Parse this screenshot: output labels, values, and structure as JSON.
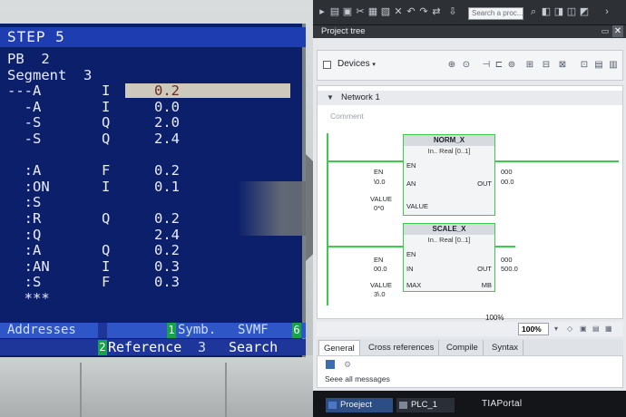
{
  "step5": {
    "title": "STEP 5",
    "lines": [
      {
        "c1": "PB  2",
        "c2": "",
        "c3": ""
      },
      {
        "c1": "Segment  3",
        "c2": "",
        "c3": ""
      },
      {
        "c1": "---A",
        "c2": "I",
        "c3": "0.2",
        "highlight": true
      },
      {
        "c1": "  -A",
        "c2": "I",
        "c3": "0.0"
      },
      {
        "c1": "  -S",
        "c2": "Q",
        "c3": "2.0"
      },
      {
        "c1": "  -S",
        "c2": "Q",
        "c3": "2.4"
      },
      {
        "c1": "",
        "c2": "",
        "c3": ""
      },
      {
        "c1": "  :A",
        "c2": "F",
        "c3": "0.2"
      },
      {
        "c1": "  :ON",
        "c2": "I",
        "c3": "0.1"
      },
      {
        "c1": "  :S",
        "c2": "",
        "c3": ""
      },
      {
        "c1": "  :R",
        "c2": "Q",
        "c3": "0.2"
      },
      {
        "c1": "  :Q",
        "c2": "",
        "c3": "2.4"
      },
      {
        "c1": "  :A",
        "c2": "Q",
        "c3": "0.2"
      },
      {
        "c1": "  :AN",
        "c2": "I",
        "c3": "0.3"
      },
      {
        "c1": "  :S",
        "c2": "F",
        "c3": "0.3"
      },
      {
        "c1": "  ***",
        "c2": "",
        "c3": ""
      }
    ],
    "fkeys": {
      "addresses": "Addresses",
      "symb_num": "1",
      "symb": "Symb.",
      "svmf": "SVMF",
      "k6": "6",
      "ref_num": "2",
      "reference": "Reference",
      "search_num": "3",
      "search": "Search"
    }
  },
  "tia": {
    "search_placeholder": "Search a proc...",
    "project_tree_title": "Project tree",
    "devices_label": "Devices",
    "network_title": "Network 1",
    "comment_label": "Comment",
    "norm_block": {
      "title": "NORM_X",
      "subtitle": "In.. Real [0..1]",
      "pin_en": "EN",
      "pin_an": "AN",
      "pin_value": "VALUE",
      "pin_out": "OUT",
      "op_en": "EN",
      "op_in": "\\0.0",
      "op_value": "VALUE",
      "op_value_v": "0*0",
      "out_val1": "000",
      "out_val2": "00.0"
    },
    "scale_block": {
      "title": "SCALE_X",
      "subtitle": "In.. Real [0..1]",
      "pin_en": "EN",
      "pin_in": "IN",
      "pin_max": "MAX",
      "pin_out": "OUT",
      "pin_mb": "MB",
      "op_en": "EN",
      "op_in": "00.0",
      "op_value": "VALUE",
      "op_value_v": "3\\.0",
      "out_val1": "000",
      "out_val2": "500.0"
    },
    "pct_label": "100%",
    "zoom_value": "100%",
    "tabs": [
      "General",
      "Cross references",
      "Compile",
      "Syntax"
    ],
    "see_all": "Seee all messages",
    "taskbar": {
      "project": "Proeject",
      "plc": "PLC_1",
      "brand": "TIAPortal"
    }
  },
  "colors": {
    "step5_bg": "#0b1f6b",
    "step5_title_bar": "#1e3db0",
    "fkey_green": "#18a24a",
    "ladder_green": "#3ccb4c",
    "tia_dark": "#2d3035"
  }
}
